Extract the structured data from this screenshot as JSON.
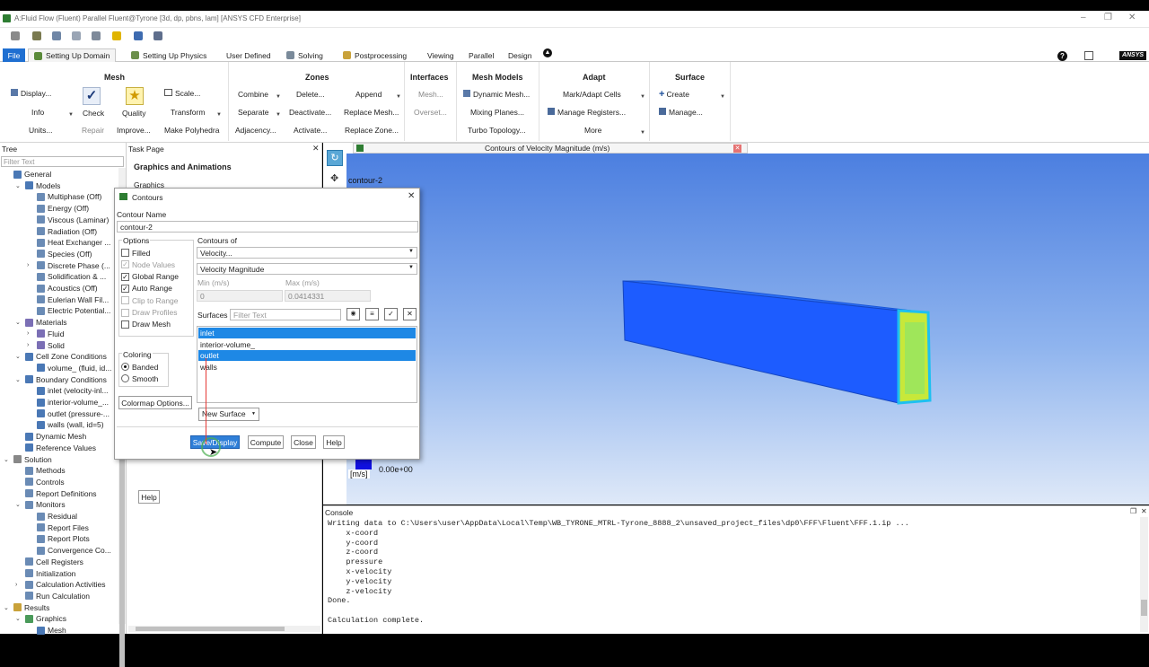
{
  "window": {
    "title": "A:Fluid Flow (Fluent) Parallel Fluent@Tyrone  [3d, dp, pbns, lam] [ANSYS CFD Enterprise]"
  },
  "tabs": [
    {
      "label": "File"
    },
    {
      "label": "Setting Up Domain"
    },
    {
      "label": "Setting Up Physics"
    },
    {
      "label": "User Defined"
    },
    {
      "label": "Solving"
    },
    {
      "label": "Postprocessing"
    },
    {
      "label": "Viewing"
    },
    {
      "label": "Parallel"
    },
    {
      "label": "Design"
    }
  ],
  "brand": "ANSYS",
  "ribbon": {
    "mesh": {
      "title": "Mesh",
      "display": "Display...",
      "info": "Info",
      "units": "Units...",
      "check": "Check",
      "repair": "Repair",
      "quality": "Quality",
      "improve": "Improve...",
      "scale": "Scale...",
      "transform": "Transform",
      "make_polyhedra": "Make Polyhedra"
    },
    "zones": {
      "title": "Zones",
      "combine": "Combine",
      "separate": "Separate",
      "adjacency": "Adjacency...",
      "delete": "Delete...",
      "deactivate": "Deactivate...",
      "activate": "Activate...",
      "append": "Append",
      "replace_mesh": "Replace Mesh...",
      "replace_zone": "Replace Zone..."
    },
    "interfaces": {
      "title": "Interfaces",
      "mesh": "Mesh...",
      "overset": "Overset..."
    },
    "mesh_models": {
      "title": "Mesh Models",
      "dynamic_mesh": "Dynamic Mesh...",
      "mixing_planes": "Mixing Planes...",
      "turbo_topology": "Turbo Topology..."
    },
    "adapt": {
      "title": "Adapt",
      "mark_adapt": "Mark/Adapt Cells",
      "manage_registers": "Manage Registers...",
      "more": "More"
    },
    "surface": {
      "title": "Surface",
      "create": "Create",
      "manage": "Manage..."
    }
  },
  "tree": {
    "header": "Tree",
    "filter_placeholder": "Filter Text",
    "items": [
      "General",
      "Models",
      "Multiphase (Off)",
      "Energy (Off)",
      "Viscous (Laminar)",
      "Radiation (Off)",
      "Heat Exchanger ...",
      "Species (Off)",
      "Discrete Phase (...",
      "Solidification & ...",
      "Acoustics (Off)",
      "Eulerian Wall Fil...",
      "Electric Potential...",
      "Materials",
      "Fluid",
      "Solid",
      "Cell Zone Conditions",
      "volume_ (fluid, id...",
      "Boundary Conditions",
      "inlet (velocity-inl...",
      "interior-volume_...",
      "outlet (pressure-...",
      "walls (wall, id=5)",
      "Dynamic Mesh",
      "Reference Values",
      "Solution",
      "Methods",
      "Controls",
      "Report Definitions",
      "Monitors",
      "Residual",
      "Report Files",
      "Report Plots",
      "Convergence Co...",
      "Cell Registers",
      "Initialization",
      "Calculation Activities",
      "Run Calculation",
      "Results",
      "Graphics",
      "Mesh"
    ]
  },
  "task_page": {
    "header": "Task Page",
    "title": "Graphics and Animations",
    "graphics_label": "Graphics",
    "help": "Help"
  },
  "graphics": {
    "tab_title": "Contours of Velocity Magnitude (m/s)",
    "overlay": "contour-2",
    "legend_value": "0.00e+00",
    "legend_unit": "[m/s]"
  },
  "console": {
    "header": "Console",
    "lines": [
      "Writing data to C:\\Users\\user\\AppData\\Local\\Temp\\WB_TYRONE_MTRL-Tyrone_8888_2\\unsaved_project_files\\dp0\\FFF\\Fluent\\FFF.1.ip ...",
      "    x-coord",
      "    y-coord",
      "    z-coord",
      "    pressure",
      "    x-velocity",
      "    y-velocity",
      "    z-velocity",
      "Done.",
      "",
      "Calculation complete."
    ]
  },
  "dialog": {
    "title": "Contours",
    "name_label": "Contour Name",
    "name_value": "contour-2",
    "options_label": "Options",
    "options": [
      {
        "label": "Filled",
        "checked": false,
        "enabled": true
      },
      {
        "label": "Node Values",
        "checked": true,
        "enabled": false
      },
      {
        "label": "Global Range",
        "checked": true,
        "enabled": true
      },
      {
        "label": "Auto Range",
        "checked": true,
        "enabled": true
      },
      {
        "label": "Clip to Range",
        "checked": false,
        "enabled": false
      },
      {
        "label": "Draw Profiles",
        "checked": false,
        "enabled": false
      },
      {
        "label": "Draw Mesh",
        "checked": false,
        "enabled": true
      }
    ],
    "coloring_label": "Coloring",
    "coloring": [
      {
        "label": "Banded",
        "selected": true
      },
      {
        "label": "Smooth",
        "selected": false
      }
    ],
    "colormap_button": "Colormap Options...",
    "contours_of_label": "Contours of",
    "contours_of_1": "Velocity...",
    "contours_of_2": "Velocity Magnitude",
    "min_label": "Min (m/s)",
    "max_label": "Max (m/s)",
    "min_value": "0",
    "max_value": "0.0414331",
    "surfaces_label": "Surfaces",
    "surfaces_filter_placeholder": "Filter Text",
    "surfaces": [
      {
        "label": "inlet",
        "selected": true
      },
      {
        "label": "interior-volume_",
        "selected": false
      },
      {
        "label": "outlet",
        "selected": true
      },
      {
        "label": "walls",
        "selected": false
      }
    ],
    "new_surface": "New Surface",
    "buttons": {
      "save_display": "Save/Display",
      "compute": "Compute",
      "close": "Close",
      "help": "Help"
    }
  }
}
